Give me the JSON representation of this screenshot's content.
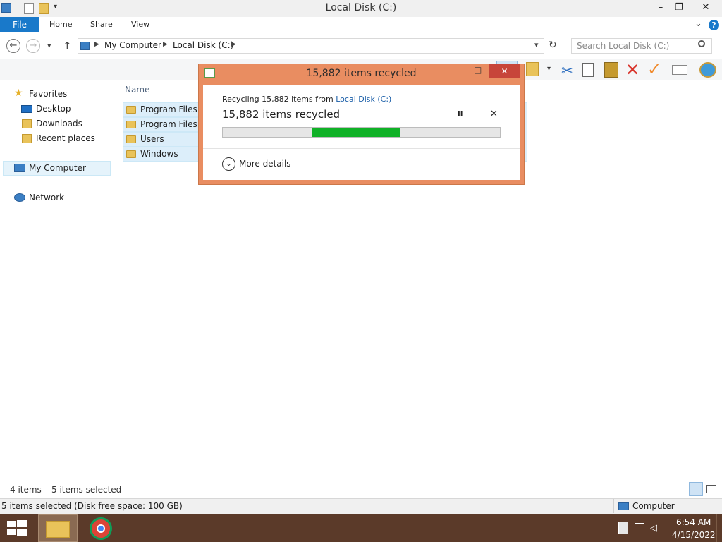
{
  "window": {
    "title": "Local Disk (C:)",
    "minimize": "–",
    "maximize": "❐",
    "close": "✕"
  },
  "ribbon": {
    "file": "File",
    "home": "Home",
    "share": "Share",
    "view": "View",
    "expand": "⌄",
    "help": "?"
  },
  "nav": {
    "back": "←",
    "forward": "→",
    "recent": "▾",
    "up": "↑",
    "breadcrumb": [
      "My Computer",
      "Local Disk (C:)"
    ],
    "refresh": "↻",
    "search_placeholder": "Search Local Disk (C:)"
  },
  "navpane": {
    "favorites": "Favorites",
    "desktop": "Desktop",
    "downloads": "Downloads",
    "recent_places": "Recent places",
    "my_computer": "My Computer",
    "network": "Network"
  },
  "filelist": {
    "column_name": "Name",
    "rows": [
      "Program Files",
      "Program Files (x86)",
      "Users",
      "Windows"
    ]
  },
  "dialog": {
    "title": "15,882 items recycled",
    "recycling_prefix": "Recycling 15,882 items from ",
    "recycling_link": "Local Disk (C:)",
    "status": "15,882 items recycled",
    "pause": "II",
    "cancel": "✕",
    "more_details": "More details",
    "minimize": "–",
    "maximize": "□",
    "close": "✕",
    "progress_start": 0.32,
    "progress_end": 0.64
  },
  "status": {
    "items": "4 items",
    "selected": "5 items selected",
    "details": "5 items selected (Disk free space: 100 GB)",
    "computer": "Computer"
  },
  "taskbar": {
    "time": "6:54 AM",
    "date": "4/15/2022"
  },
  "colors": {
    "accent": "#1979ca",
    "dialog_border": "#e98d61",
    "progress": "#10b127",
    "taskbar": "#5b3a29"
  }
}
